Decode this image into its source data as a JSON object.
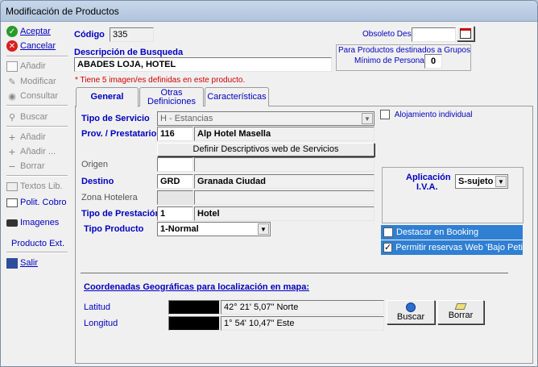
{
  "window": {
    "title": "Modificación de Productos"
  },
  "toolbar": {
    "aceptar": "Aceptar",
    "cancelar": "Cancelar",
    "anadir": "Añadir",
    "modificar": "Modificar",
    "consultar": "Consultar",
    "buscar": "Buscar",
    "anadir2": "Añadir",
    "anadir3": "Añadir ...",
    "borrar": "Borrar",
    "textos": "Textos Lib.",
    "polit": "Polit. Cobro",
    "imagenes": "Imagenes",
    "producto_ext": "Producto Ext.",
    "salir": "Salir"
  },
  "header": {
    "codigo_label": "Código",
    "codigo_value": "335",
    "obsoleto_label": "Obsoleto Desde",
    "obsoleto_value": "",
    "descripcion_label": "Descripción de Busqueda",
    "descripcion_value": "ABADES LOJA, HOTEL",
    "grupos_line1": "Para Productos destinados a Grupos",
    "grupos_line2": "Mínimo de Personas",
    "grupos_value": "0",
    "warning": "* Tiene 5 imagen/es definidas en este producto."
  },
  "tabs": {
    "general": "General",
    "otras_1": "Otras",
    "otras_2": "Definiciones",
    "caracteristicas": "Características"
  },
  "general": {
    "tipo_servicio_label": "Tipo de Servicio",
    "tipo_servicio_value": "H - Estancias",
    "prov_label": "Prov. / Prestatario",
    "prov_code": "116",
    "prov_name": "Alp Hotel Masella",
    "definir_button": "Definir Descriptivos web de Servicios",
    "origen_label": "Origen",
    "origen_code": "",
    "origen_name": "",
    "destino_label": "Destino",
    "destino_code": "GRD",
    "destino_name": "Granada Ciudad",
    "zona_label": "Zona Hotelera",
    "zona_code": "",
    "zona_name": "",
    "tipo_prestacion_label": "Tipo de Prestación",
    "tipo_prestacion_code": "1",
    "tipo_prestacion_name": "Hotel",
    "tipo_producto_label": "Tipo Producto",
    "tipo_producto_value": "1-Normal",
    "alojamiento_label": "Alojamiento individual",
    "iva_label_1": "Aplicación",
    "iva_label_2": "I.V.A.",
    "iva_value": "S-sujeto",
    "destacar_label": "Destacar en Booking",
    "destacar_checked": false,
    "permitir_label": "Permitir reservas Web 'Bajo Petición'",
    "permitir_checked": true,
    "coords_title": "Coordenadas Geográficas para localización en mapa:",
    "latitud_label": "Latitud",
    "latitud_value": "42° 21' 5,07\" Norte",
    "longitud_label": "Longitud",
    "longitud_value": "1° 54' 10,47\" Este",
    "buscar_button": "Buscar",
    "borrar_button": "Borrar"
  },
  "colors": {
    "accent": "#0000c0",
    "highlight": "#2f7fd3",
    "warning": "#d00000"
  }
}
